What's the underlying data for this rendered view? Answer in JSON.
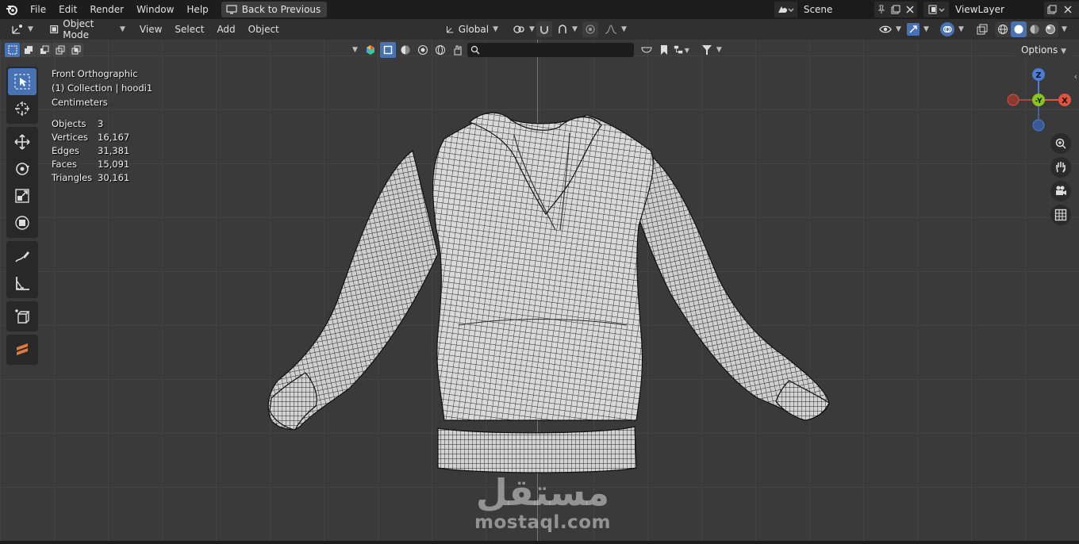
{
  "menu": {
    "items": [
      "File",
      "Edit",
      "Render",
      "Window",
      "Help"
    ],
    "back_label": "Back to Previous",
    "scene": "Scene",
    "view_layer": "ViewLayer"
  },
  "header": {
    "mode": "Object Mode",
    "items": [
      "View",
      "Select",
      "Add",
      "Object"
    ],
    "orientation": "Global",
    "options": "Options"
  },
  "viewport": {
    "view_name": "Front Orthographic",
    "collection": "(1) Collection | hoodi1",
    "units": "Centimeters",
    "stats": [
      {
        "label": "Objects",
        "value": "3"
      },
      {
        "label": "Vertices",
        "value": "16,167"
      },
      {
        "label": "Edges",
        "value": "31,381"
      },
      {
        "label": "Faces",
        "value": "15,091"
      },
      {
        "label": "Triangles",
        "value": "30,161"
      }
    ],
    "gizmo": {
      "z": "Z",
      "y": "-Y",
      "x": "X"
    }
  },
  "watermark": {
    "arabic": "مستقل",
    "latin": "mostaql.com"
  },
  "colors": {
    "accent": "#4772b3",
    "x_axis": "#e0533f",
    "y_axis": "#8ac41f",
    "z_axis": "#4d7ed6"
  }
}
